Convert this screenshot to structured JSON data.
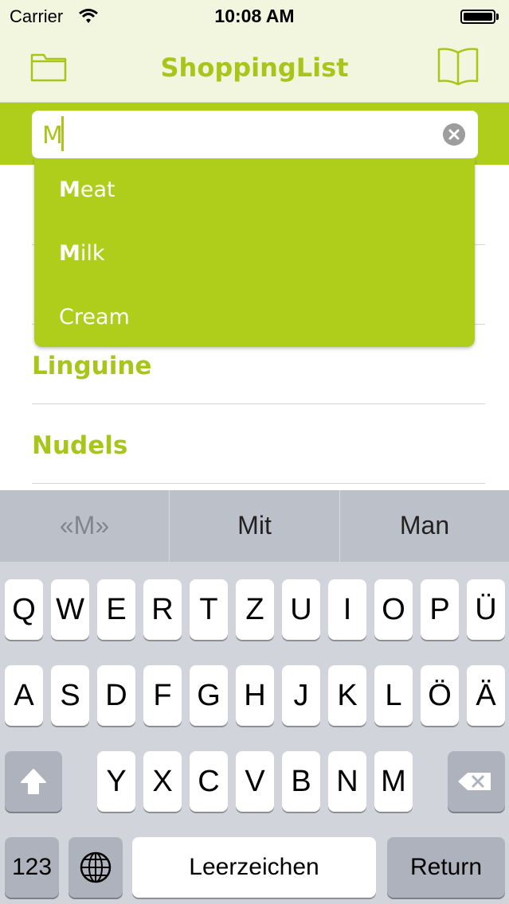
{
  "status_bar": {
    "carrier": "Carrier",
    "time": "10:08 AM"
  },
  "nav": {
    "title": "ShoppingList",
    "left_icon": "folder-icon",
    "right_icon": "book-icon"
  },
  "search": {
    "value": "M",
    "clear_icon": "clear-icon"
  },
  "suggestions": [
    {
      "prefix": "M",
      "rest": "eat"
    },
    {
      "prefix": "M",
      "rest": "ilk"
    },
    {
      "prefix": "",
      "rest": "Cream"
    }
  ],
  "list_items": [
    "Linguine",
    "Nudels"
  ],
  "predictions": [
    "«M»",
    "Mit",
    "Man"
  ],
  "keyboard": {
    "row1": [
      "Q",
      "W",
      "E",
      "R",
      "T",
      "Z",
      "U",
      "I",
      "O",
      "P",
      "Ü"
    ],
    "row2": [
      "A",
      "S",
      "D",
      "F",
      "G",
      "H",
      "J",
      "K",
      "L",
      "Ö",
      "Ä"
    ],
    "row3": [
      "Y",
      "X",
      "C",
      "V",
      "B",
      "N",
      "M"
    ],
    "numbers_label": "123",
    "space_label": "Leerzeichen",
    "return_label": "Return"
  },
  "colors": {
    "accent": "#aece1b",
    "nav_background": "#f3f6de",
    "list_text": "#a8c51b"
  }
}
